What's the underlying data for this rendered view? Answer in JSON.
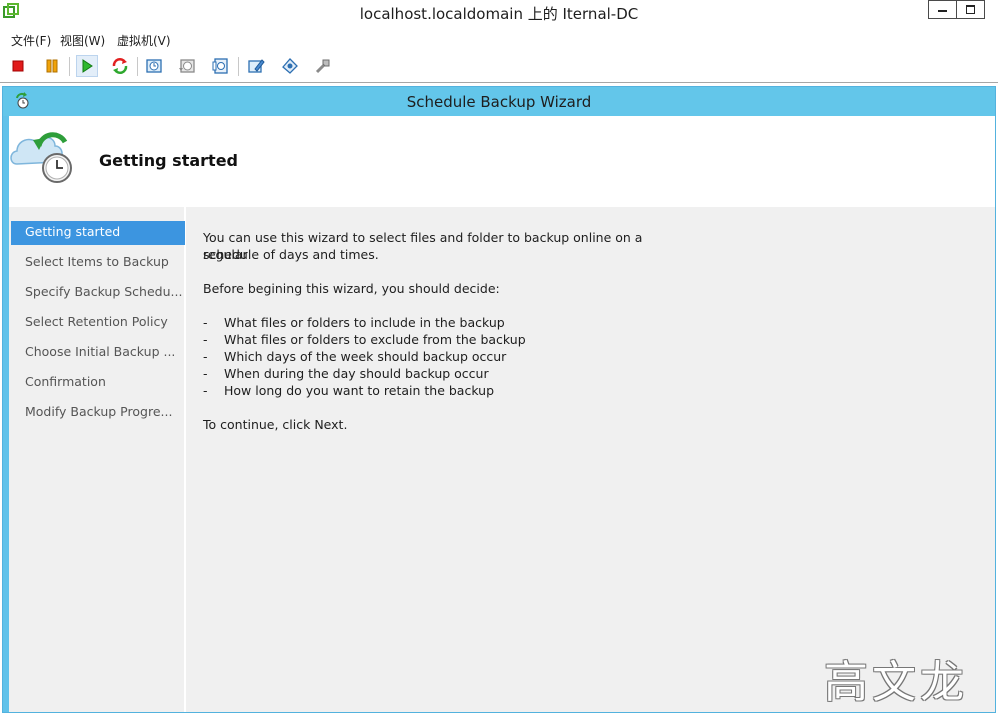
{
  "window": {
    "title": "localhost.localdomain 上的 Iternal-DC"
  },
  "menu": {
    "items": [
      "文件(F)",
      "视图(W)",
      "虚拟机(V)"
    ]
  },
  "toolbar": {
    "buttons": [
      "stop-icon",
      "pause-icon",
      "play-icon",
      "refresh-icon",
      "snapshot-icon",
      "revert-snapshot-icon",
      "manage-snapshot-icon",
      "edit-settings-icon",
      "disk-icon",
      "tools-icon"
    ]
  },
  "wizard": {
    "title": "Schedule Backup Wizard",
    "header_title": "Getting started",
    "nav": [
      "Getting started",
      "Select Items to Backup",
      "Specify Backup Schedu...",
      "Select Retention Policy",
      "Choose Initial Backup ...",
      "Confirmation",
      "Modify Backup Progre..."
    ],
    "selected_index": 0,
    "content": {
      "intro_line1": "You can use this wizard to select files and folder to backup online on a regular",
      "intro_line2": "schedule of days and times.",
      "decide": "Before begining this wizard, you should decide:",
      "bullets": [
        "What files or folders to include in the backup",
        "What files or folders to exclude from the backup",
        "Which days of the week should backup occur",
        "When during the day should backup occur",
        "How long do you want to retain the backup"
      ],
      "continue": "To continue, click Next."
    }
  },
  "watermark": "高文龙",
  "colors": {
    "title_bar": "#63c6ea",
    "selected_nav": "#3c95e0",
    "panel_bg": "#f0f0f0"
  }
}
